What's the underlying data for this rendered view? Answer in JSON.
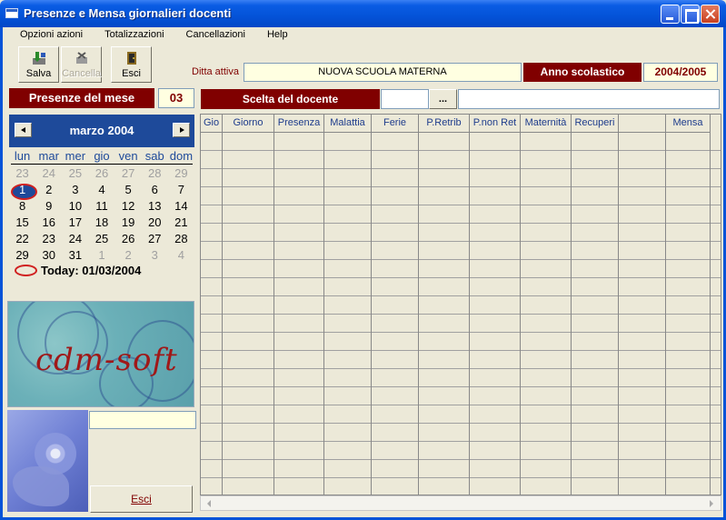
{
  "window": {
    "title": "Presenze e Mensa giornalieri docenti"
  },
  "menu": [
    "Opzioni azioni",
    "Totalizzazioni",
    "Cancellazioni",
    "Help"
  ],
  "toolbar": {
    "save": "Salva",
    "delete": "Cancella",
    "exit": "Esci"
  },
  "ditta": {
    "label": "Ditta attiva",
    "value": "NUOVA SCUOLA MATERNA"
  },
  "anno": {
    "label": "Anno scolastico",
    "value": "2004/2005"
  },
  "presenze": {
    "label": "Presenze del mese",
    "value": "03"
  },
  "scelta": {
    "label": "Scelta del docente",
    "button": "...",
    "code": "",
    "name": ""
  },
  "calendar": {
    "month": "marzo 2004",
    "dow": [
      "lun",
      "mar",
      "mer",
      "gio",
      "ven",
      "sab",
      "dom"
    ],
    "weeks": [
      [
        "23",
        "24",
        "25",
        "26",
        "27",
        "28",
        "29"
      ],
      [
        "1",
        "2",
        "3",
        "4",
        "5",
        "6",
        "7"
      ],
      [
        "8",
        "9",
        "10",
        "11",
        "12",
        "13",
        "14"
      ],
      [
        "15",
        "16",
        "17",
        "18",
        "19",
        "20",
        "21"
      ],
      [
        "22",
        "23",
        "24",
        "25",
        "26",
        "27",
        "28"
      ],
      [
        "29",
        "30",
        "31",
        "1",
        "2",
        "3",
        "4"
      ]
    ],
    "today": "Today: 01/03/2004"
  },
  "logo": {
    "text": "cdm-soft"
  },
  "side": {
    "field_value": "",
    "exit_button": "Esci"
  },
  "grid": {
    "columns": [
      "Gio",
      "Giorno",
      "Presenza",
      "Malattia",
      "Ferie",
      "P.Retrib",
      "P.non Ret",
      "Maternità",
      "Recuperi",
      "",
      "Mensa"
    ]
  },
  "colors": {
    "accent": "#800000",
    "calendar": "#1e4a9a",
    "titlebar": "#0453d8"
  }
}
